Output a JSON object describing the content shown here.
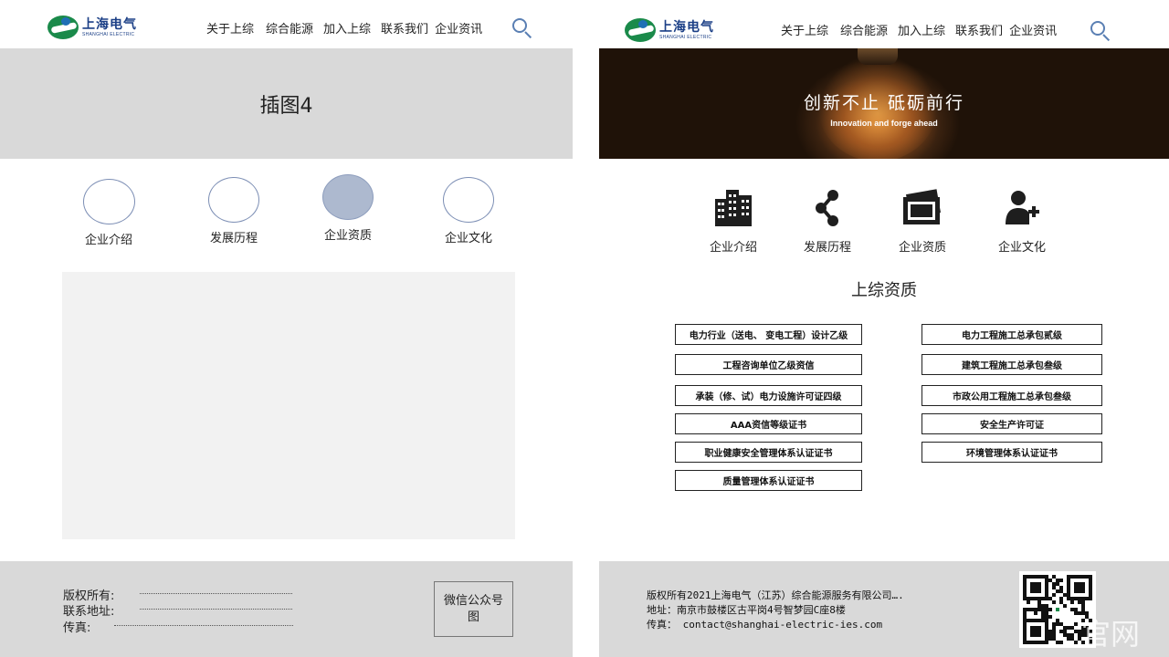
{
  "left": {
    "logo": {
      "cn": "上海电气",
      "en": "SHANGHAI ELECTRIC"
    },
    "nav": [
      "关于上综",
      "综合能源",
      "加入上综",
      "联系我们",
      "企业资讯"
    ],
    "banner_text": "插图4",
    "tabs": [
      {
        "label": "企业介绍",
        "active": false
      },
      {
        "label": "发展历程",
        "active": false
      },
      {
        "label": "企业资质",
        "active": true
      },
      {
        "label": "企业文化",
        "active": false
      }
    ],
    "footer": {
      "copyright_label": "版权所有:",
      "address_label": "联系地址:",
      "fax_label": "传真:",
      "wechat": "微信公众号图"
    }
  },
  "right": {
    "logo": {
      "cn": "上海电气",
      "en": "SHANGHAI ELECTRIC"
    },
    "nav": [
      "关于上综",
      "综合能源",
      "加入上综",
      "联系我们",
      "企业资讯"
    ],
    "banner": {
      "title": "创新不止  砥砺前行",
      "subtitle": "Innovation and forge ahead"
    },
    "tabs": [
      {
        "label": "企业介绍",
        "icon": "buildings-icon"
      },
      {
        "label": "发展历程",
        "icon": "share-nodes-icon"
      },
      {
        "label": "企业资质",
        "icon": "certificate-frame-icon"
      },
      {
        "label": "企业文化",
        "icon": "user-plus-icon"
      }
    ],
    "section_title": "上综资质",
    "certs_left": [
      "电力行业（送电、 变电工程）设计乙级",
      "工程咨询单位乙级资信",
      "承装（修、试）电力设施许可证四级",
      "AAA资信等级证书",
      "职业健康安全管理体系认证证书",
      "质量管理体系认证证书"
    ],
    "certs_right": [
      "电力工程施工总承包贰级",
      "建筑工程施工总承包叁级",
      "市政公用工程施工总承包叁级",
      "安全生产许可证",
      "环境管理体系认证证书"
    ],
    "footer": {
      "line1": "版权所有2021上海电气（江苏）综合能源服务有限公司….",
      "line2": "地址：南京市鼓楼区古平岗4号智梦园C座8楼",
      "line3": "传真：  contact@shanghai-electric-ies.com"
    },
    "watermark": "官网"
  },
  "colors": {
    "brand_blue": "#1b3f86",
    "brand_green": "#1a8a4a",
    "panel_gray": "#d9d9d9",
    "active_tab": "#adb9cf"
  }
}
